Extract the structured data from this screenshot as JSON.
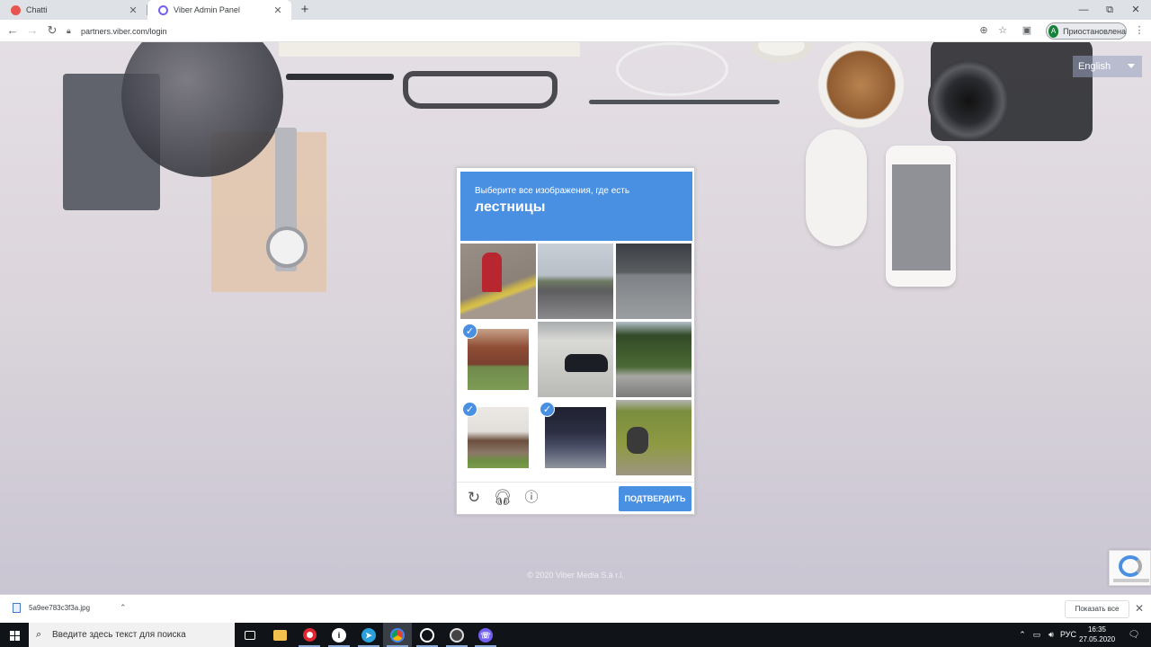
{
  "browser": {
    "tabs": [
      {
        "label": "Chatti",
        "favicon_color": "#e8554e"
      },
      {
        "label": "Viber Admin Panel",
        "favicon_color": "#7360f2"
      }
    ],
    "new_tab": "+",
    "window_controls": [
      "—",
      "⧉",
      "✕"
    ],
    "url": "partners.viber.com/login",
    "profile": {
      "initial": "А",
      "label": "Приостановлена"
    }
  },
  "page": {
    "language": "English",
    "footer": "© 2020 Viber Media S.à r.l."
  },
  "captcha": {
    "instruction": "Выберите все изображения, где есть",
    "target": "лестницы",
    "verify_label": "ПОДТВЕРДИТЬ",
    "check_glyph": "✓",
    "tiles": [
      {
        "name": "tile-hydrant",
        "selected": false
      },
      {
        "name": "tile-street",
        "selected": false
      },
      {
        "name": "tile-overpass",
        "selected": false
      },
      {
        "name": "tile-stairs-porch",
        "selected": true
      },
      {
        "name": "tile-car",
        "selected": false
      },
      {
        "name": "tile-hill-road",
        "selected": false
      },
      {
        "name": "tile-stairs-house",
        "selected": true
      },
      {
        "name": "tile-stairs-dark",
        "selected": true
      },
      {
        "name": "tile-motorcycle",
        "selected": false
      }
    ],
    "accent_color": "#4a90e2"
  },
  "downloads": {
    "file": "5a9ee783c3f3a.jpg",
    "show_all": "Показать все"
  },
  "taskbar": {
    "search_placeholder": "Введите здесь текст для поиска",
    "language": "РУС",
    "time": "16:35",
    "date": "27.05.2020"
  }
}
